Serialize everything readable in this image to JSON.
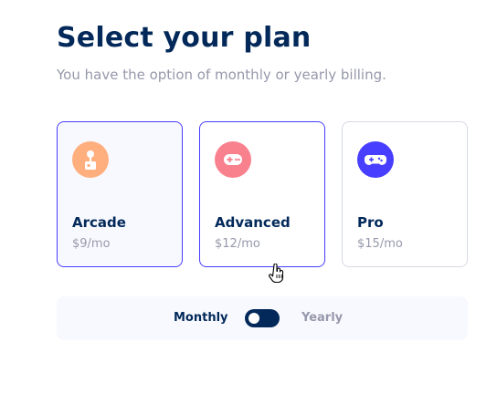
{
  "header": {
    "title": "Select your plan",
    "subtitle": "You have the option of monthly or yearly billing."
  },
  "plans": [
    {
      "name": "Arcade",
      "price": "$9/mo",
      "icon": "arcade-joystick-icon",
      "icon_color": "#ffaf7e",
      "selected": true
    },
    {
      "name": "Advanced",
      "price": "$12/mo",
      "icon": "gamepad-icon",
      "icon_color": "#f9818e",
      "selected": false
    },
    {
      "name": "Pro",
      "price": "$15/mo",
      "icon": "controller-icon",
      "icon_color": "#483eff",
      "selected": false
    }
  ],
  "billing": {
    "monthly_label": "Monthly",
    "yearly_label": "Yearly",
    "selected": "Monthly"
  },
  "colors": {
    "primary": "#02295a",
    "accent": "#473dff",
    "muted": "#9699ab",
    "border": "#d6d9e6",
    "light_bg": "#f8f9fe"
  }
}
